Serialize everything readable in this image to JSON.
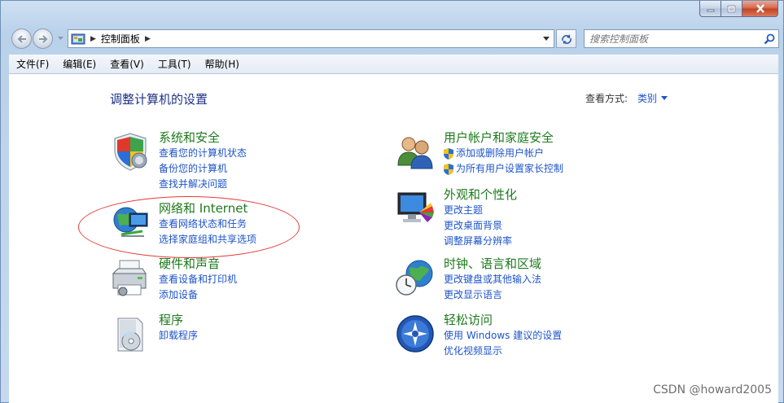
{
  "window": {
    "caption_buttons": [
      "minimize",
      "maximize",
      "close"
    ]
  },
  "nav": {
    "address_path": "控制面板",
    "search_placeholder": "搜索控制面板"
  },
  "menu": [
    "文件(F)",
    "编辑(E)",
    "查看(V)",
    "工具(T)",
    "帮助(H)"
  ],
  "page": {
    "title": "调整计算机的设置",
    "view_by_label": "查看方式:",
    "view_by_value": "类别"
  },
  "categories_left": [
    {
      "title": "系统和安全",
      "icon": "shield-icon",
      "links": [
        "查看您的计算机状态",
        "备份您的计算机",
        "查找并解决问题"
      ]
    },
    {
      "title": "网络和 Internet",
      "icon": "network-globe-icon",
      "links": [
        "查看网络状态和任务",
        "选择家庭组和共享选项"
      ]
    },
    {
      "title": "硬件和声音",
      "icon": "printer-icon",
      "links": [
        "查看设备和打印机",
        "添加设备"
      ]
    },
    {
      "title": "程序",
      "icon": "programs-icon",
      "links": [
        "卸载程序"
      ]
    }
  ],
  "categories_right": [
    {
      "title": "用户帐户和家庭安全",
      "icon": "users-icon",
      "links": [
        "添加或删除用户帐户",
        "为所有用户设置家长控制"
      ]
    },
    {
      "title": "外观和个性化",
      "icon": "monitor-icon",
      "links": [
        "更改主题",
        "更改桌面背景",
        "调整屏幕分辨率"
      ]
    },
    {
      "title": "时钟、语言和区域",
      "icon": "clock-globe-icon",
      "links": [
        "更改键盘或其他输入法",
        "更改显示语言"
      ]
    },
    {
      "title": "轻松访问",
      "icon": "ease-of-access-icon",
      "links": [
        "使用 Windows 建议的设置",
        "优化视频显示"
      ]
    }
  ],
  "watermark": "CSDN @howard2005",
  "colors": {
    "link": "#1e54c9",
    "category_title": "#1d7a1d",
    "page_title": "#1e3287",
    "annotation_oval": "#e53a3a"
  }
}
